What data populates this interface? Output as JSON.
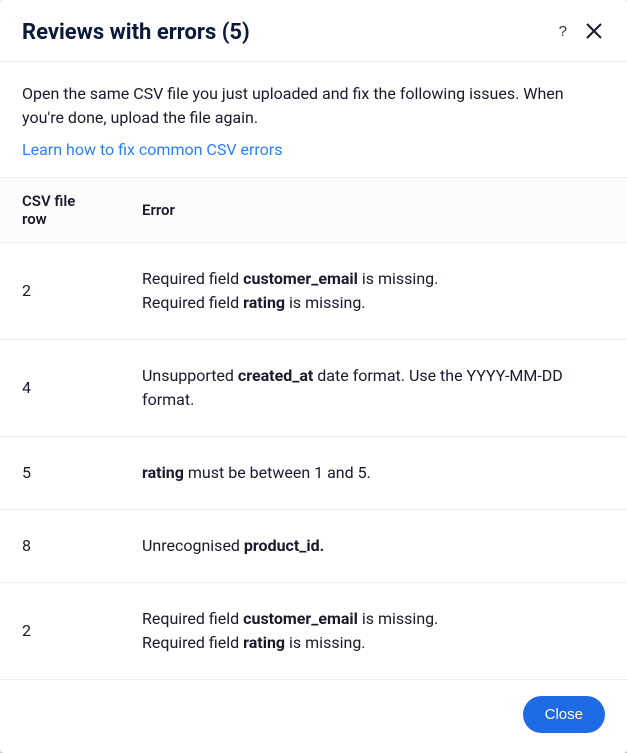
{
  "header": {
    "title": "Reviews with errors (5)"
  },
  "intro": {
    "text": "Open the same CSV file you just uploaded and fix the following issues. When you're done, upload the file again.",
    "link_label": "Learn how to fix common CSV errors"
  },
  "table": {
    "headers": {
      "row": "CSV file row",
      "error": "Error"
    },
    "rows": [
      {
        "row": "2",
        "errors": [
          {
            "pre": "Required field ",
            "bold": "customer_email",
            "post": " is missing."
          },
          {
            "pre": "Required field ",
            "bold": "rating",
            "post": " is missing."
          }
        ]
      },
      {
        "row": "4",
        "errors": [
          {
            "pre": "Unsupported ",
            "bold": "created_at",
            "post": " date format. Use the YYYY-MM-DD format."
          }
        ]
      },
      {
        "row": "5",
        "errors": [
          {
            "pre": "",
            "bold": "rating",
            "post": " must be between 1 and 5."
          }
        ]
      },
      {
        "row": "8",
        "errors": [
          {
            "pre": "Unrecognised ",
            "bold": "product_id.",
            "post": ""
          }
        ]
      },
      {
        "row": "2",
        "errors": [
          {
            "pre": "Required field ",
            "bold": "customer_email",
            "post": " is missing."
          },
          {
            "pre": "Required field ",
            "bold": "rating",
            "post": " is missing."
          }
        ]
      }
    ]
  },
  "footer": {
    "close_label": "Close"
  }
}
